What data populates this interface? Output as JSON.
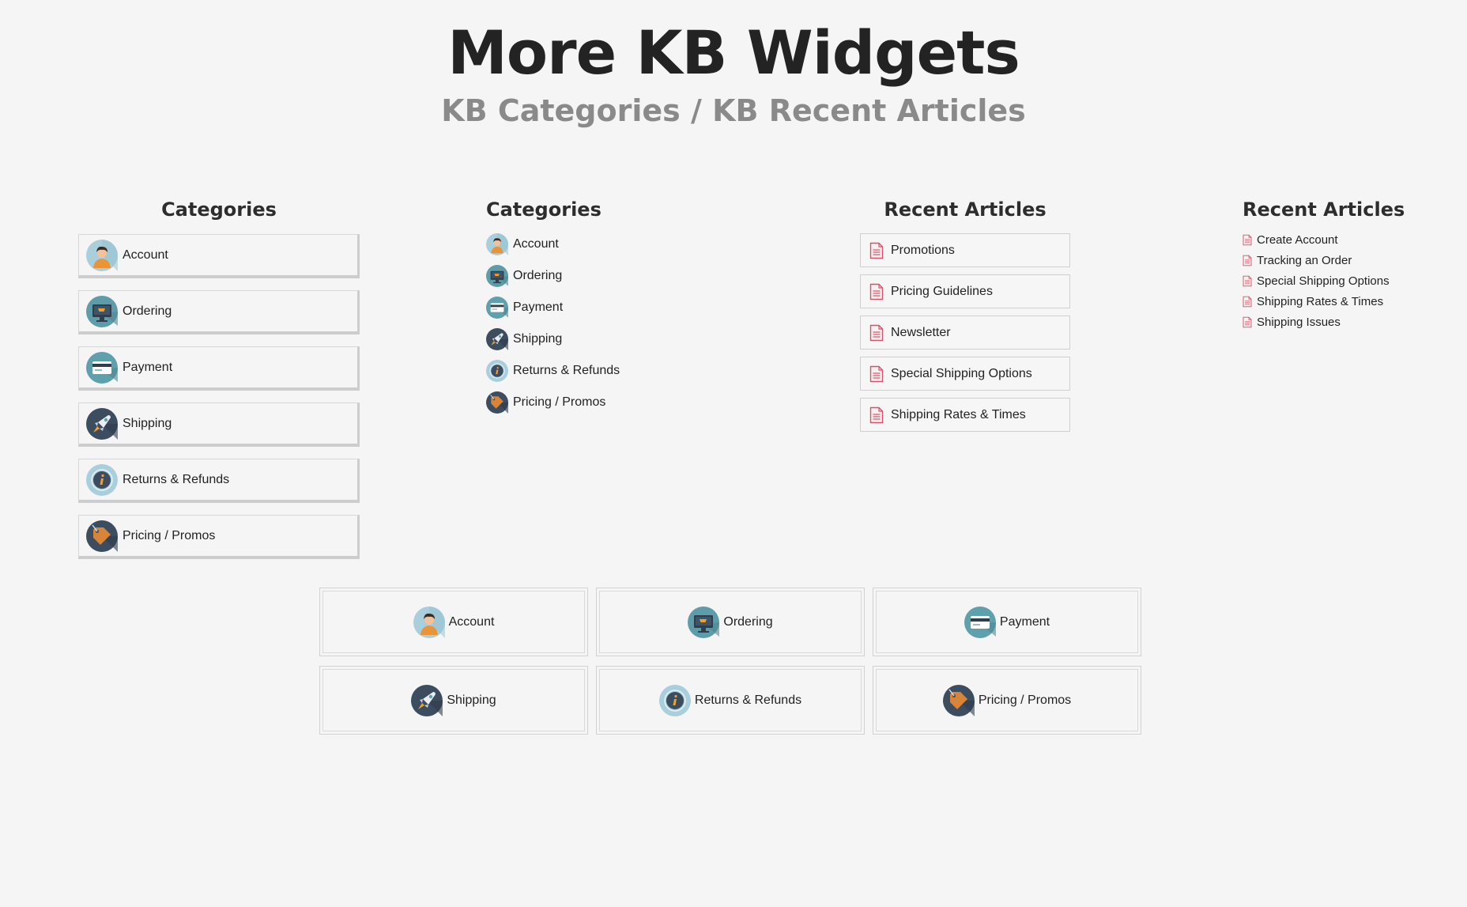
{
  "hero": {
    "title": "More KB Widgets",
    "subtitle": "KB Categories / KB Recent Articles"
  },
  "categories_boxed": {
    "title": "Categories",
    "items": [
      {
        "label": "Account",
        "icon": "account-icon"
      },
      {
        "label": "Ordering",
        "icon": "ordering-icon"
      },
      {
        "label": "Payment",
        "icon": "payment-icon"
      },
      {
        "label": "Shipping",
        "icon": "shipping-icon"
      },
      {
        "label": "Returns & Refunds",
        "icon": "returns-icon"
      },
      {
        "label": "Pricing / Promos",
        "icon": "pricing-icon"
      }
    ]
  },
  "categories_list": {
    "title": "Categories",
    "items": [
      {
        "label": "Account",
        "icon": "account-icon"
      },
      {
        "label": "Ordering",
        "icon": "ordering-icon"
      },
      {
        "label": "Payment",
        "icon": "payment-icon"
      },
      {
        "label": "Shipping",
        "icon": "shipping-icon"
      },
      {
        "label": "Returns & Refunds",
        "icon": "returns-icon"
      },
      {
        "label": "Pricing / Promos",
        "icon": "pricing-icon"
      }
    ]
  },
  "recent_boxed": {
    "title": "Recent Articles",
    "items": [
      {
        "label": "Promotions"
      },
      {
        "label": "Pricing Guidelines"
      },
      {
        "label": "Newsletter"
      },
      {
        "label": "Special Shipping Options"
      },
      {
        "label": "Shipping Rates & Times"
      }
    ]
  },
  "recent_list": {
    "title": "Recent Articles",
    "items": [
      {
        "label": "Create Account"
      },
      {
        "label": "Tracking an Order"
      },
      {
        "label": "Special Shipping Options"
      },
      {
        "label": "Shipping Rates & Times"
      },
      {
        "label": "Shipping Issues"
      }
    ]
  },
  "category_grid": {
    "items": [
      {
        "label": "Account",
        "icon": "account-icon"
      },
      {
        "label": "Ordering",
        "icon": "ordering-icon"
      },
      {
        "label": "Payment",
        "icon": "payment-icon"
      },
      {
        "label": "Shipping",
        "icon": "shipping-icon"
      },
      {
        "label": "Returns & Refunds",
        "icon": "returns-icon"
      },
      {
        "label": "Pricing / Promos",
        "icon": "pricing-icon"
      }
    ]
  },
  "colors": {
    "background": "#f5f5f5",
    "doc_icon": "#d0566b",
    "icon_dark": "#3d4d60",
    "icon_teal": "#5fa0ad",
    "icon_light": "#a9cfdc"
  }
}
